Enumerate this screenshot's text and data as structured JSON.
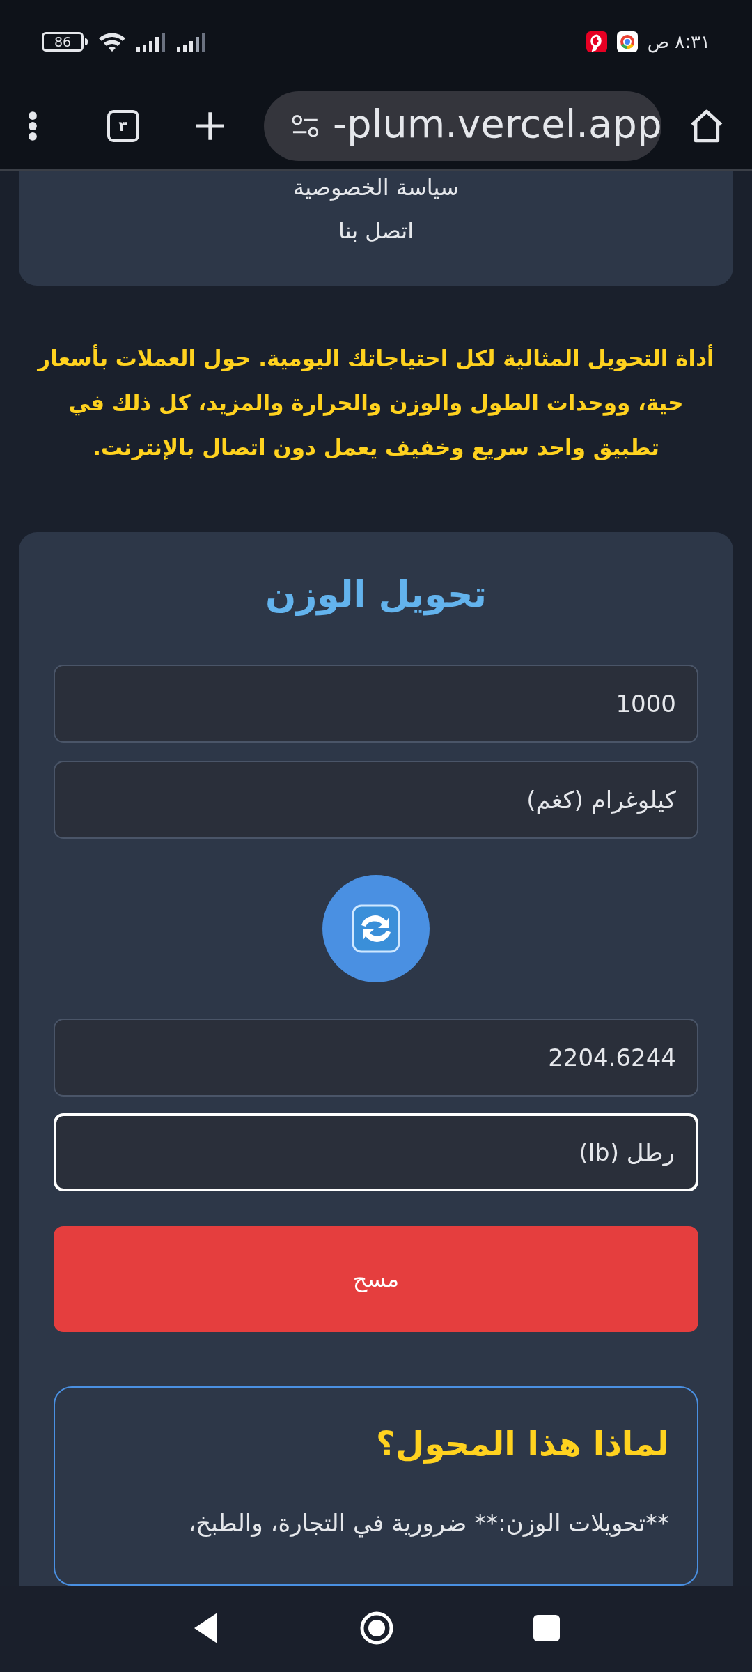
{
  "status_bar": {
    "time": "٨:٣١ ص",
    "battery": "86"
  },
  "browser": {
    "url": "-plum.vercel.app",
    "tab_count": "٣"
  },
  "menu": {
    "items": [
      "سياسة الخصوصية",
      "اتصل بنا"
    ]
  },
  "intro": "أداة التحويل المثالية لكل احتياجاتك اليومية. حول العملات بأسعار حية، ووحدات الطول والوزن والحرارة والمزيد، كل ذلك في تطبيق واحد سريع وخفيف يعمل دون اتصال بالإنترنت.",
  "converter": {
    "title": "تحويل الوزن",
    "amount_input": {
      "value": "1000"
    },
    "from_unit": {
      "value": "كيلوغرام (كغم)",
      "focused": false
    },
    "result": {
      "value": "2204.6244"
    },
    "to_unit": {
      "value": "رطل (lb)",
      "focused": true
    },
    "clear_button": "مسح"
  },
  "info": {
    "title": "لماذا هذا المحول؟",
    "text": "**تحويلات الوزن:** ضرورية في التجارة، والطبخ،"
  }
}
